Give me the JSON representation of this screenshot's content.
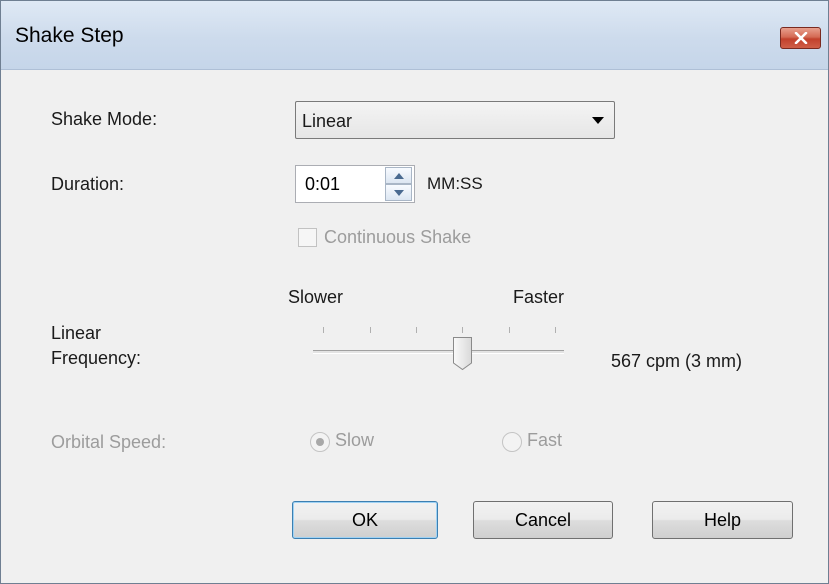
{
  "window": {
    "title": "Shake Step"
  },
  "form": {
    "shake_mode_label": "Shake Mode:",
    "shake_mode_value": "Linear",
    "duration_label": "Duration:",
    "duration_value": "0:01",
    "duration_unit": "MM:SS",
    "continuous_shake_label": "Continuous Shake",
    "continuous_shake_checked": false,
    "continuous_shake_enabled": false,
    "frequency_label_line1": "Linear",
    "frequency_label_line2": "Frequency:",
    "slider_min_label": "Slower",
    "slider_max_label": "Faster",
    "frequency_value": "567 cpm (3 mm)",
    "slider_position_fraction": 0.6,
    "orbital_speed_label": "Orbital Speed:",
    "orbital_speed_enabled": false,
    "orbital_options": [
      {
        "label": "Slow",
        "selected": true
      },
      {
        "label": "Fast",
        "selected": false
      }
    ]
  },
  "buttons": {
    "ok_label": "OK",
    "cancel_label": "Cancel",
    "help_label": "Help"
  },
  "icons": {
    "close": "close-icon",
    "dropdown": "chevron-down-icon",
    "spin_up": "spin-up-icon",
    "spin_down": "spin-down-icon"
  },
  "colors": {
    "title_bar": "#cddbec",
    "close_button": "#c2412c",
    "dialog_background": "#f0f0f0",
    "default_button_border": "#3c7fb1",
    "disabled_text": "#9c9c9c"
  }
}
